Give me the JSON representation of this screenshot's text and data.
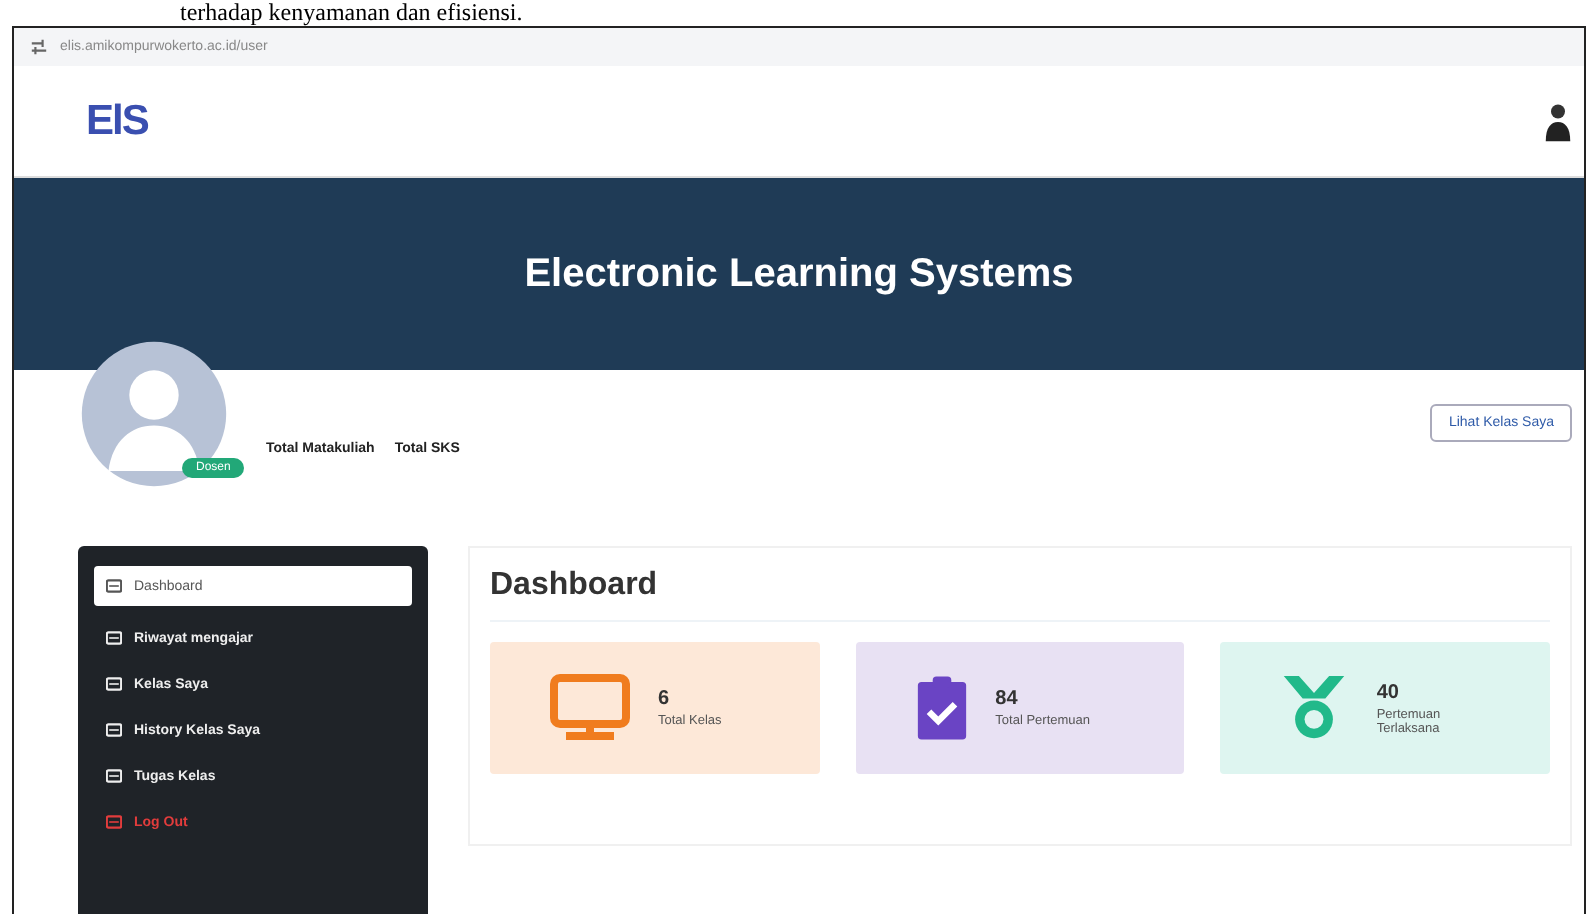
{
  "document_text": "terhadap kenyamanan dan efisiensi.",
  "browser": {
    "url": "elis.amikompurwokerto.ac.id/user"
  },
  "header": {
    "logo": "ElS"
  },
  "banner": {
    "title": "Electronic Learning Systems"
  },
  "profile": {
    "badge": "Dosen",
    "stats": [
      "Total Matakuliah",
      "Total SKS"
    ],
    "button": "Lihat Kelas Saya"
  },
  "sidebar": {
    "items": [
      {
        "label": "Dashboard",
        "selected": true,
        "kind": "normal"
      },
      {
        "label": "Riwayat mengajar",
        "selected": false,
        "kind": "normal"
      },
      {
        "label": "Kelas Saya",
        "selected": false,
        "kind": "normal"
      },
      {
        "label": "History Kelas Saya",
        "selected": false,
        "kind": "normal"
      },
      {
        "label": "Tugas Kelas",
        "selected": false,
        "kind": "normal"
      },
      {
        "label": "Log Out",
        "selected": false,
        "kind": "danger"
      }
    ]
  },
  "dashboard": {
    "title": "Dashboard",
    "cards": [
      {
        "kind": "monitor",
        "value": "6",
        "label": "Total Kelas",
        "color": "#fde8d8"
      },
      {
        "kind": "clipboard",
        "value": "84",
        "label": "Total Pertemuan",
        "color": "#e8e1f3"
      },
      {
        "kind": "medal",
        "value": "40",
        "label": "Pertemuan Terlaksana",
        "color": "#def5f0"
      }
    ]
  }
}
